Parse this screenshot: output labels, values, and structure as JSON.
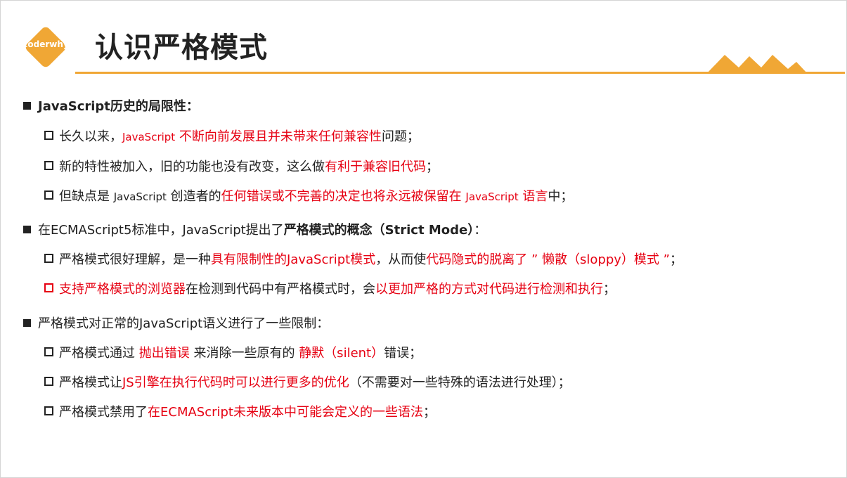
{
  "logo": {
    "text": "coderwhy"
  },
  "title": "认识严格模式",
  "colors": {
    "accent": "#f0a735",
    "highlight": "#e60012",
    "text": "#222222"
  },
  "sections": [
    {
      "heading": "JavaScript历史的局限性：",
      "items": [
        {
          "pre": "长久以来，",
          "red_small": "JavaScript",
          "red": " 不断向前发展且并未带来任何兼容性",
          "post": "问题；"
        },
        {
          "pre": "新的特性被加入，旧的功能也没有改变，这么做",
          "red": "有利于兼容旧代码",
          "post": "；"
        },
        {
          "pre1": "但缺点是 ",
          "small1": "JavaScript",
          "pre2": " 创造者的",
          "red": "任何错误或不完善的决定也将永远被保留在 ",
          "red_small": "JavaScript",
          "red2": " 语言",
          "post": "中；"
        }
      ]
    },
    {
      "heading_pre": "在ECMAScript5标准中，JavaScript提出了",
      "heading_bold": "严格模式的概念（Strict Mode）",
      "heading_post": "：",
      "items": [
        {
          "pre": "严格模式很好理解，是一种",
          "red1": "具有限制性的JavaScript模式",
          "mid": "，从而使",
          "red2": "代码隐式的脱离了 ” 懒散（sloppy）模式 ”",
          "post": "；"
        },
        {
          "red1": "支持严格模式的浏览器",
          "mid": "在检测到代码中有严格模式时，会",
          "red2": "以更加严格的方式对代码进行检测和执行",
          "post": "；"
        }
      ]
    },
    {
      "heading": "严格模式对正常的JavaScript语义进行了一些限制：",
      "items": [
        {
          "pre": "严格模式通过 ",
          "red1": "抛出错误",
          "mid": " 来消除一些原有的 ",
          "red2": "静默（silent）",
          "post": "错误；"
        },
        {
          "pre": "严格模式让",
          "red": "JS引擎在执行代码时可以进行更多的优化",
          "post": "（不需要对一些特殊的语法进行处理）；"
        },
        {
          "pre": "严格模式禁用了",
          "red": "在ECMAScript未来版本中可能会定义的一些语法",
          "post": "；"
        }
      ]
    }
  ]
}
